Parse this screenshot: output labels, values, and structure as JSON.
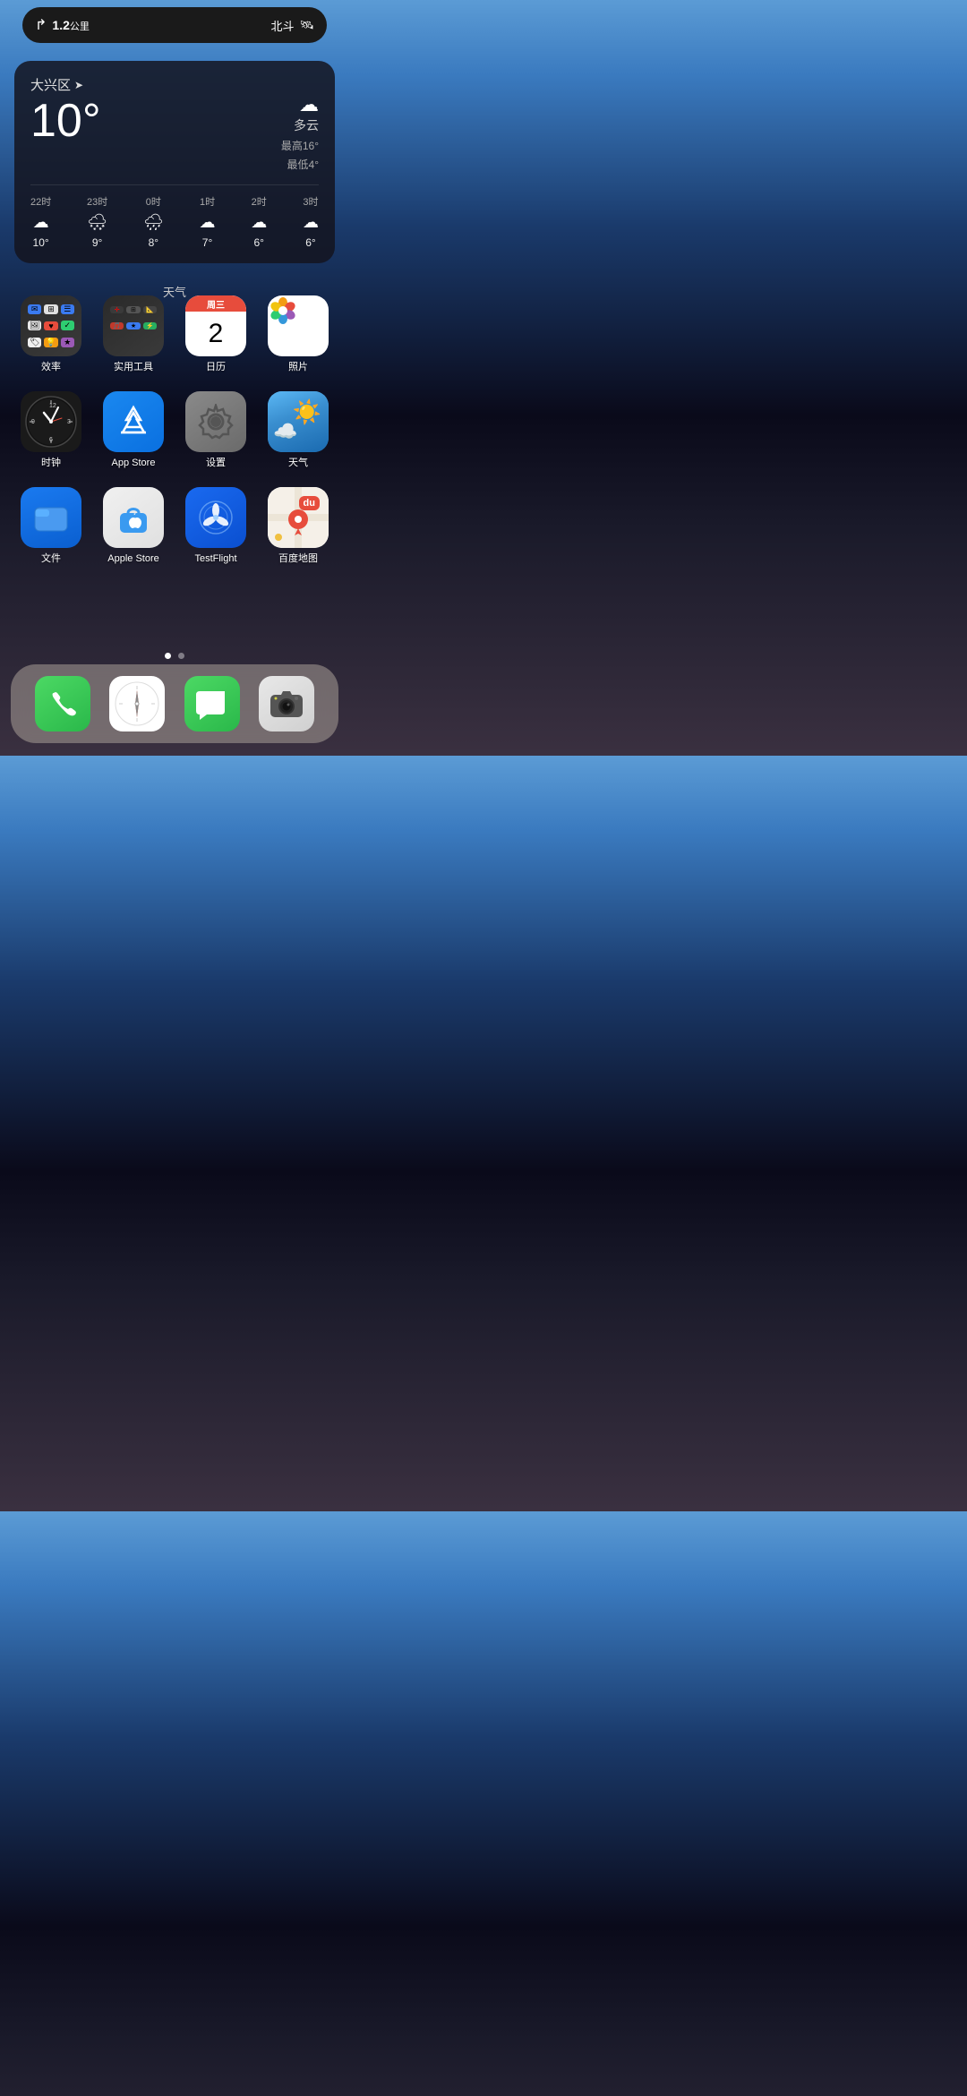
{
  "nav": {
    "distance": "1.2",
    "unit": "公里",
    "arrow": "↱",
    "service": "北斗",
    "service_icon": "🛰"
  },
  "weather": {
    "location": "大兴区",
    "location_icon": "➤",
    "temperature": "10°",
    "condition": "多云",
    "high": "最高16°",
    "low": "最低4°",
    "cloud_icon": "☁",
    "hourly": [
      {
        "time": "22时",
        "icon": "☁",
        "temp": "10°"
      },
      {
        "time": "23时",
        "icon": "🌨",
        "temp": "9°"
      },
      {
        "time": "0时",
        "icon": "🌧",
        "temp": "8°"
      },
      {
        "time": "1时",
        "icon": "☁",
        "temp": "7°"
      },
      {
        "time": "2时",
        "icon": "☁",
        "temp": "6°"
      },
      {
        "time": "3时",
        "icon": "☁",
        "temp": "6°"
      }
    ],
    "widget_label": "天气"
  },
  "apps": {
    "row1": [
      {
        "id": "efficiency",
        "label": "效率",
        "type": "folder"
      },
      {
        "id": "tools",
        "label": "实用工具",
        "type": "folder"
      },
      {
        "id": "calendar",
        "label": "日历",
        "type": "calendar",
        "day_name": "周三",
        "day_num": "2"
      },
      {
        "id": "photos",
        "label": "照片",
        "type": "photos"
      }
    ],
    "row2": [
      {
        "id": "clock",
        "label": "时钟",
        "type": "clock"
      },
      {
        "id": "appstore",
        "label": "App Store",
        "type": "appstore"
      },
      {
        "id": "settings",
        "label": "设置",
        "type": "settings"
      },
      {
        "id": "weather",
        "label": "天气",
        "type": "weather"
      }
    ],
    "row3": [
      {
        "id": "files",
        "label": "文件",
        "type": "files"
      },
      {
        "id": "applestore",
        "label": "Apple Store",
        "type": "applestore"
      },
      {
        "id": "testflight",
        "label": "TestFlight",
        "type": "testflight"
      },
      {
        "id": "baidu",
        "label": "百度地图",
        "type": "baidu"
      }
    ]
  },
  "dock": {
    "apps": [
      {
        "id": "phone",
        "label": "电话",
        "type": "phone"
      },
      {
        "id": "safari",
        "label": "Safari",
        "type": "safari"
      },
      {
        "id": "messages",
        "label": "信息",
        "type": "messages"
      },
      {
        "id": "camera",
        "label": "相机",
        "type": "camera"
      }
    ]
  },
  "page_dots": {
    "total": 2,
    "active": 0
  }
}
